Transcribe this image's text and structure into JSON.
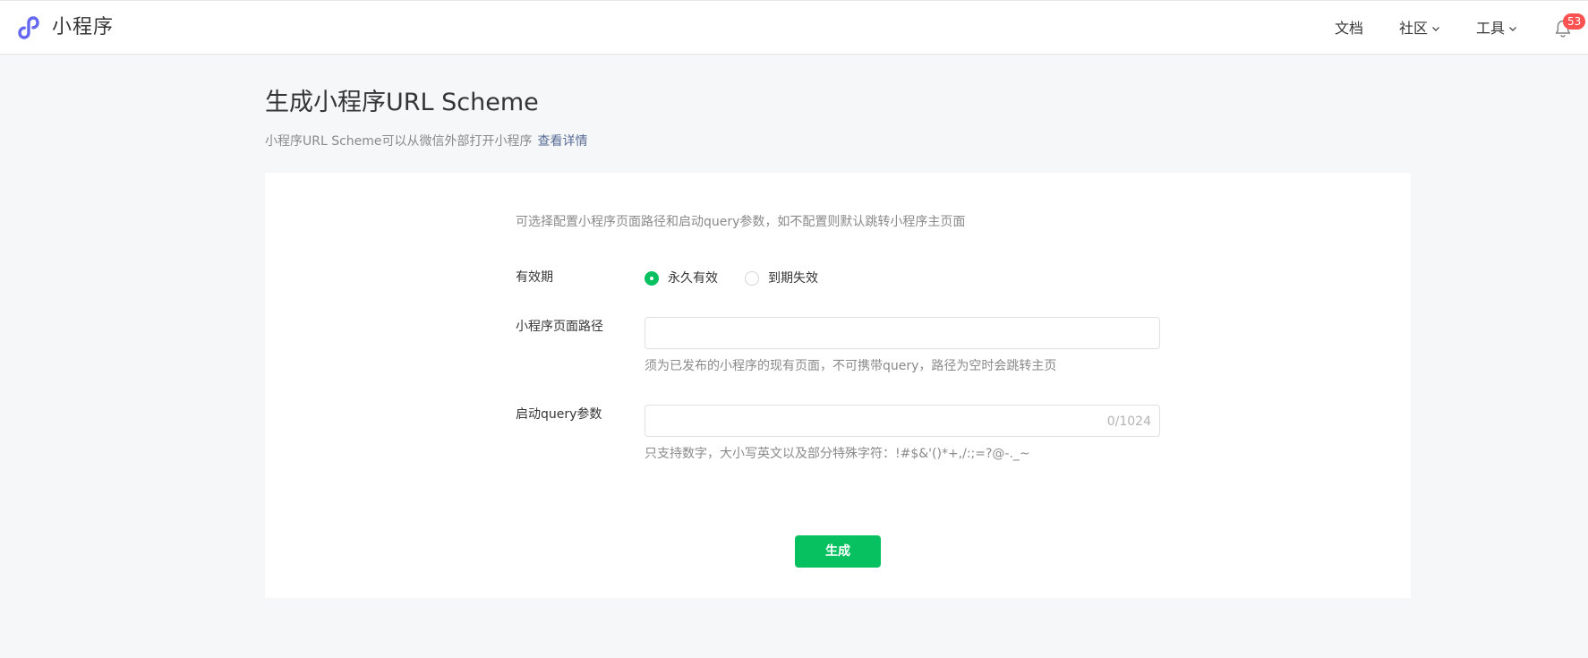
{
  "header": {
    "logo_icon": "miniprogram-logo-icon",
    "brand": "小程序",
    "nav": [
      {
        "label": "文档",
        "dropdown": false
      },
      {
        "label": "社区",
        "dropdown": true
      },
      {
        "label": "工具",
        "dropdown": true
      }
    ],
    "notification_icon": "bell-icon",
    "notification_count": "53"
  },
  "main": {
    "title": "生成小程序URL Scheme",
    "subtitle": "小程序URL Scheme可以从微信外部打开小程序",
    "subtitle_link": "查看详情"
  },
  "form": {
    "note": "可选择配置小程序页面路径和启动query参数，如不配置则默认跳转小程序主页面",
    "validity": {
      "label": "有效期",
      "options": [
        {
          "label": "永久有效",
          "selected": true
        },
        {
          "label": "到期失效",
          "selected": false
        }
      ]
    },
    "path": {
      "label": "小程序页面路径",
      "value": "",
      "hint": "须为已发布的小程序的现有页面，不可携带query，路径为空时会跳转主页"
    },
    "query": {
      "label": "启动query参数",
      "value": "",
      "counter": "0/1024",
      "hint": "只支持数字，大小写英文以及部分特殊字符：!#$&'()*+,/:;=?@-._~"
    },
    "submit_label": "生成"
  },
  "colors": {
    "accent": "#07c160",
    "link": "#576b95",
    "badge": "#fa5151",
    "logo": "#6467f0"
  }
}
